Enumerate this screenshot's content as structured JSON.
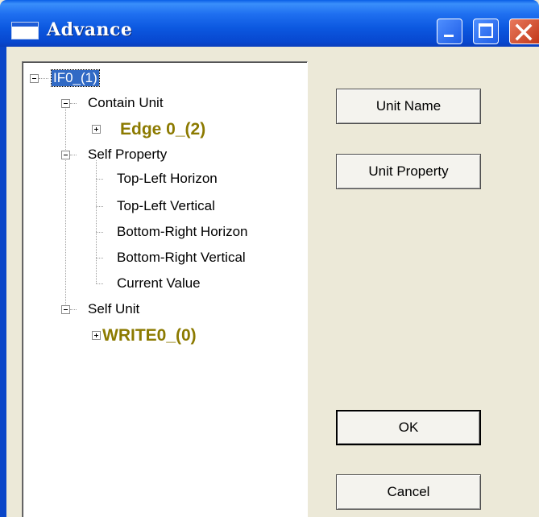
{
  "window": {
    "title": "Advance"
  },
  "tree": {
    "root": "IF0_(1)",
    "contain_unit": "Contain Unit",
    "edge_item": "Edge 0_(2)",
    "self_property": "Self Property",
    "properties": [
      "Top-Left Horizon",
      "Top-Left Vertical",
      "Bottom-Right Horizon",
      "Bottom-Right Vertical",
      "Current Value"
    ],
    "self_unit": "Self Unit",
    "write_item": "WRITE0_(0)"
  },
  "buttons": {
    "unit_name": "Unit Name",
    "unit_property": "Unit Property",
    "ok": "OK",
    "cancel": "Cancel"
  },
  "icons": [
    "window-icon",
    "minimize-icon",
    "maximize-icon",
    "close-icon",
    "expand-icon",
    "collapse-icon"
  ],
  "colors": {
    "titlebar": "#0a5fe6",
    "highlight_item": "#8c7a00",
    "selection": "#316ac5",
    "dialog_bg": "#ece9d8"
  }
}
